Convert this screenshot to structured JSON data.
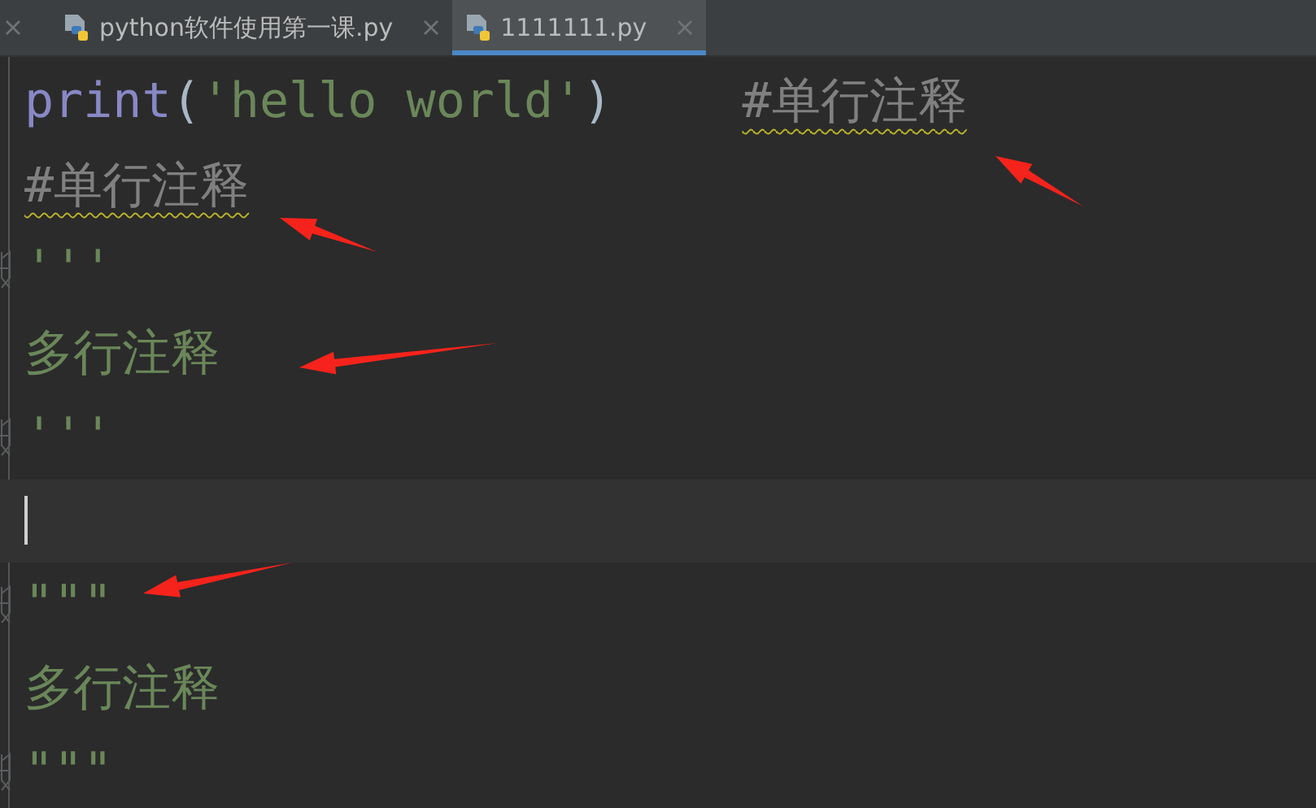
{
  "tabs": [
    {
      "selected": false,
      "kind": "cut"
    },
    {
      "label": "python软件使用第一课.py",
      "selected": false,
      "kind": "file"
    },
    {
      "label": "1111111.py",
      "selected": true,
      "kind": "file"
    }
  ],
  "editor": {
    "lines": [
      {
        "current": false,
        "fold": false,
        "tokens": [
          {
            "kind": "builtin",
            "text": "print"
          },
          {
            "kind": "paren",
            "text": "("
          },
          {
            "kind": "string",
            "text": "'hello world'"
          },
          {
            "kind": "paren",
            "text": ")"
          },
          {
            "kind": "comment",
            "text": "#单行注释",
            "warning": true
          }
        ]
      },
      {
        "current": false,
        "fold": false,
        "tokens": [
          {
            "kind": "comment",
            "text": "#单行注释",
            "warning": true
          }
        ]
      },
      {
        "current": false,
        "fold": true,
        "tokens": [
          {
            "kind": "string",
            "text": "'''"
          }
        ]
      },
      {
        "current": false,
        "fold": false,
        "tokens": [
          {
            "kind": "string",
            "text": "多行注释"
          }
        ]
      },
      {
        "current": false,
        "fold": true,
        "tokens": [
          {
            "kind": "string",
            "text": "'''"
          }
        ]
      },
      {
        "current": true,
        "fold": false
      },
      {
        "current": false,
        "fold": true,
        "tokens": [
          {
            "kind": "string",
            "text": "\"\"\""
          }
        ]
      },
      {
        "current": false,
        "fold": false,
        "tokens": [
          {
            "kind": "string",
            "text": "多行注释"
          }
        ]
      },
      {
        "current": false,
        "fold": true,
        "tokens": [
          {
            "kind": "string",
            "text": "\"\"\""
          }
        ]
      }
    ]
  }
}
